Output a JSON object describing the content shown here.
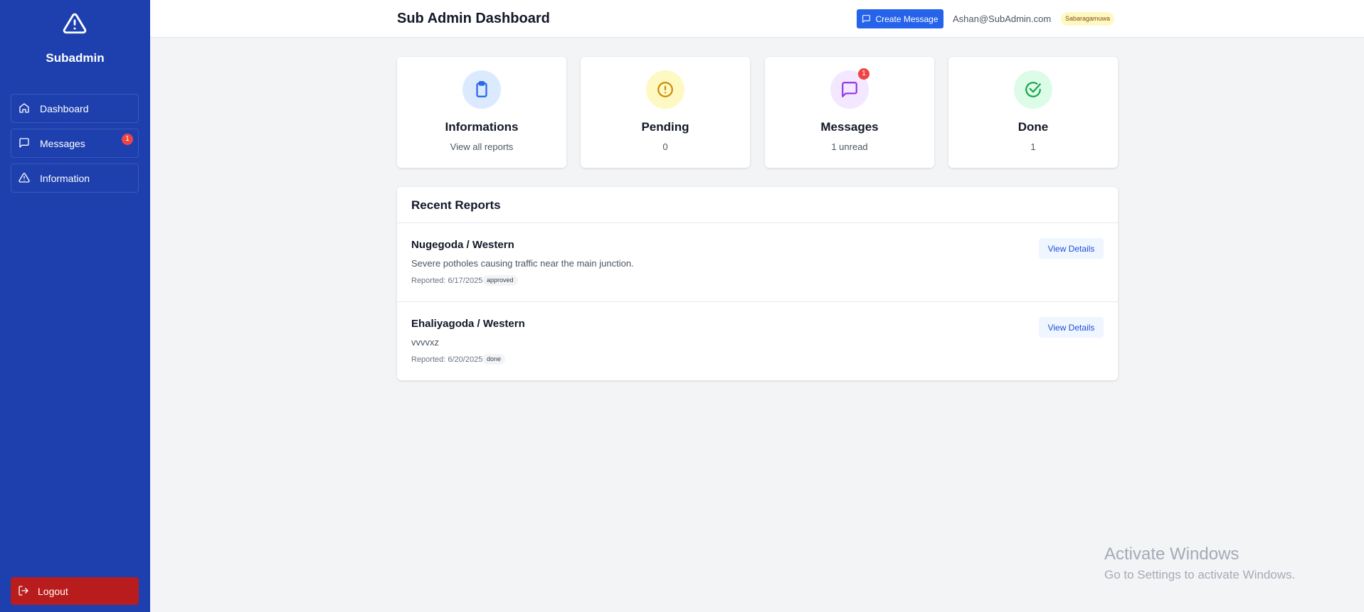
{
  "sidebar": {
    "brand": "Subadmin",
    "items": [
      {
        "label": "Dashboard",
        "icon": "home-icon"
      },
      {
        "label": "Messages",
        "icon": "message-icon",
        "badge": "1"
      },
      {
        "label": "Information",
        "icon": "warning-icon"
      }
    ],
    "logout_label": "Logout"
  },
  "header": {
    "title": "Sub Admin Dashboard",
    "create_message_label": "Create Message",
    "user_email": "Ashan@SubAdmin.com",
    "region": "Sabaragamuwa"
  },
  "cards": [
    {
      "title": "Informations",
      "subtitle": "View all reports",
      "icon": "clipboard-icon",
      "color": "#2563eb",
      "bg": "#dbeafe"
    },
    {
      "title": "Pending",
      "subtitle": "0",
      "icon": "alert-circle-icon",
      "color": "#ca8a04",
      "bg": "#fef9c3"
    },
    {
      "title": "Messages",
      "subtitle": "1 unread",
      "icon": "message-icon",
      "color": "#9333ea",
      "bg": "#f3e8ff",
      "badge": "1"
    },
    {
      "title": "Done",
      "subtitle": "1",
      "icon": "check-circle-icon",
      "color": "#16a34a",
      "bg": "#dcfce7"
    }
  ],
  "recent_reports": {
    "title": "Recent Reports",
    "view_label": "View Details",
    "rows": [
      {
        "location": "Nugegoda / Western",
        "description": "Severe potholes causing traffic near the main junction.",
        "reported": "Reported: 6/17/2025",
        "status": "approved"
      },
      {
        "location": "Ehaliyagoda / Western",
        "description": "vvvvxz",
        "reported": "Reported: 6/20/2025",
        "status": "done"
      }
    ]
  },
  "watermark": {
    "title": "Activate Windows",
    "subtitle": "Go to Settings to activate Windows."
  },
  "colors": {
    "sidebar": "#1e40af",
    "primary": "#2563eb",
    "logout": "#b91c1c",
    "badge": "#ef4444"
  }
}
